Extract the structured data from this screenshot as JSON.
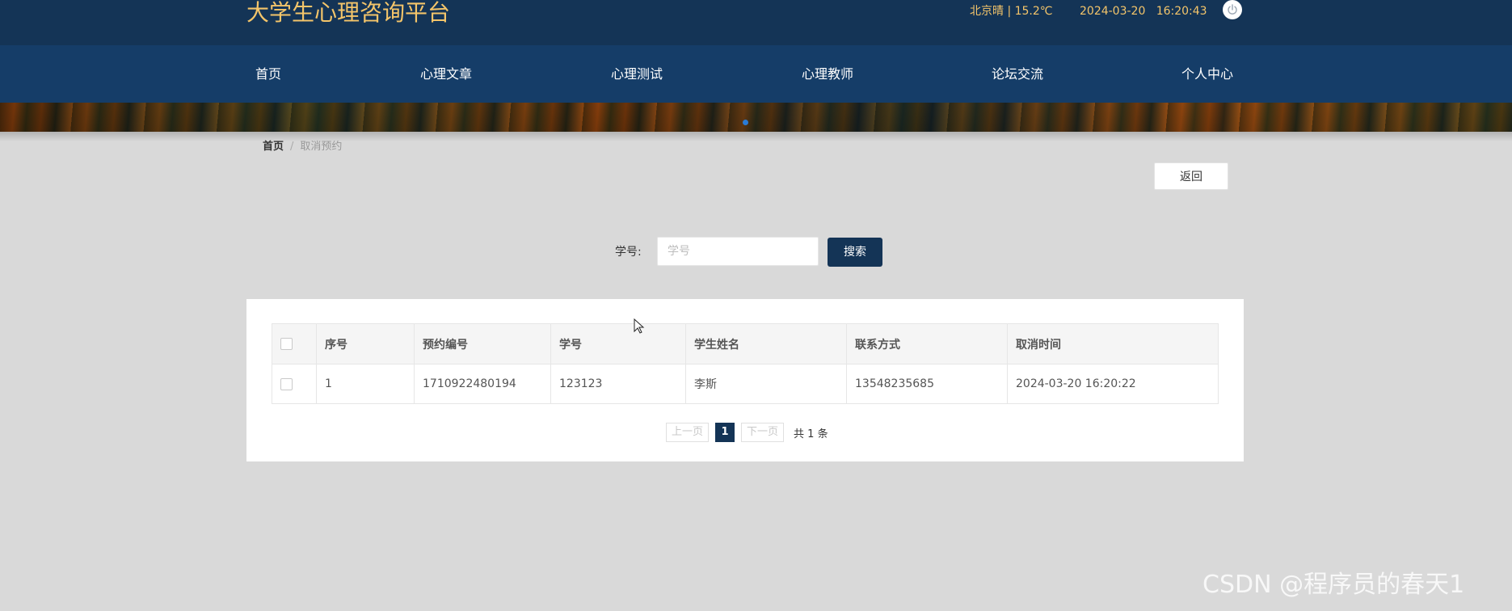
{
  "header": {
    "site_title": "大学生心理咨询平台",
    "weather": "北京晴 | 15.2℃",
    "datetime": "2024-03-20   16:20:43",
    "power_icon": "power-icon"
  },
  "nav": {
    "items": [
      {
        "label": "首页"
      },
      {
        "label": "心理文章"
      },
      {
        "label": "心理测试"
      },
      {
        "label": "心理教师"
      },
      {
        "label": "论坛交流"
      },
      {
        "label": "个人中心"
      }
    ]
  },
  "breadcrumb": {
    "home": "首页",
    "separator": "/",
    "current": "取消预约"
  },
  "actions": {
    "back_label": "返回"
  },
  "search": {
    "label": "学号:",
    "placeholder": "学号",
    "value": "",
    "button_label": "搜索"
  },
  "table": {
    "columns": [
      "序号",
      "预约编号",
      "学号",
      "学生姓名",
      "联系方式",
      "取消时间"
    ],
    "rows": [
      {
        "index": "1",
        "booking_no": "1710922480194",
        "student_id": "123123",
        "name": "李斯",
        "contact": "13548235685",
        "cancel_time": "2024-03-20 16:20:22"
      }
    ]
  },
  "pagination": {
    "prev": "上一页",
    "current": "1",
    "next": "下一页",
    "total": "共 1 条"
  },
  "watermark": "CSDN @程序员的春天1",
  "colors": {
    "header_bg": "#143456",
    "nav_bg": "#153d68",
    "title_color": "#f4c56a",
    "primary_button": "#143456",
    "page_bg": "#d9d9d9"
  }
}
